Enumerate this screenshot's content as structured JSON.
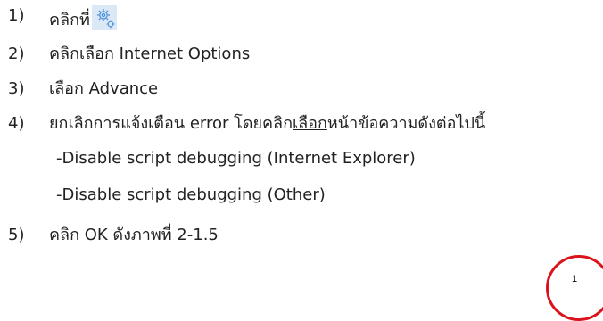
{
  "steps": [
    {
      "num": "1)",
      "text": "คลิกที่",
      "icon": "gear-icon"
    },
    {
      "num": "2)",
      "text": "คลิกเลือก Internet Options"
    },
    {
      "num": "3)",
      "text": "เลือก Advance"
    },
    {
      "num": "4)",
      "text_before": "ยกเลิกการแจ้งเตือน error โดยคลิก",
      "text_underlined": "เลือก",
      "text_after": "หน้าข้อความดังต่อไปนี้"
    },
    {
      "num": "5)",
      "text": "คลิก OK ดังภาพที่ 2-1.5"
    }
  ],
  "sub_items": [
    "-Disable script debugging (Internet Explorer)",
    "-Disable script debugging (Other)"
  ],
  "badge": {
    "label": "1",
    "color": "#d9141c"
  },
  "colors": {
    "text": "#222222",
    "gear_blue": "#4a90d9"
  }
}
